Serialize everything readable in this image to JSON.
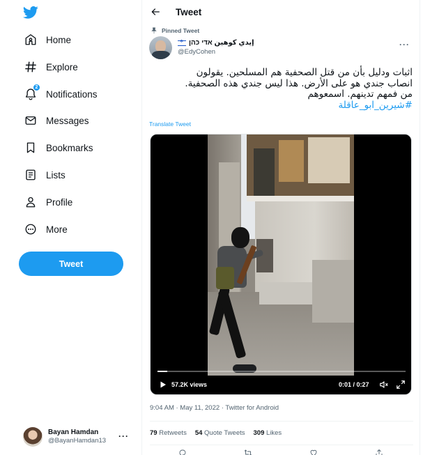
{
  "sidebar": {
    "logo_icon": "twitter-bird-icon",
    "items": [
      {
        "label": "Home",
        "icon": "home-icon"
      },
      {
        "label": "Explore",
        "icon": "hashtag-icon"
      },
      {
        "label": "Notifications",
        "icon": "bell-icon",
        "badge": "2"
      },
      {
        "label": "Messages",
        "icon": "envelope-icon"
      },
      {
        "label": "Bookmarks",
        "icon": "bookmark-icon"
      },
      {
        "label": "Lists",
        "icon": "list-icon"
      },
      {
        "label": "Profile",
        "icon": "person-icon"
      },
      {
        "label": "More",
        "icon": "more-circle-icon"
      }
    ],
    "tweet_button": "Tweet",
    "account": {
      "name": "Bayan Hamdan",
      "handle": "@BayanHamdan13",
      "more": "···"
    }
  },
  "header": {
    "title": "Tweet"
  },
  "tweet": {
    "pinned_label": "Pinned Tweet",
    "author_name": "إيدي كوهين אדי כהן",
    "author_handle": "@EdyCohen",
    "more": "···",
    "text_lines": [
      "اثبات ودليل بأن من قتل الصحفية هم المسلحين. يقولون",
      "انصاب جندي هو على الأرض. هذا ليس جندي هذه الصحفية.",
      "من فمهم تدينهم. اسمعوهم"
    ],
    "hashtag": "#شيرين_ابو_عاقلة",
    "translate": "Translate Tweet",
    "video": {
      "views": "57.2K views",
      "time": "0:01 / 0:27",
      "progress_fraction": 0.04
    },
    "meta": "9:04 AM · May 11, 2022 · Twitter for Android",
    "stats": {
      "retweets_count": "79",
      "retweets_label": "Retweets",
      "quotes_count": "54",
      "quotes_label": "Quote Tweets",
      "likes_count": "309",
      "likes_label": "Likes"
    }
  },
  "colors": {
    "accent": "#1d9bf0",
    "text": "#0f1419",
    "muted": "#536471"
  }
}
